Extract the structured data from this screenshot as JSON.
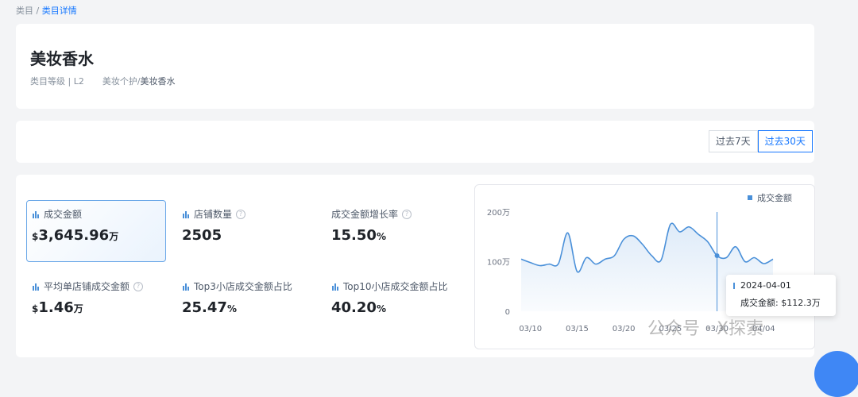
{
  "breadcrumb": {
    "root": "类目",
    "sep": "/",
    "current": "类目详情"
  },
  "category": {
    "title": "美妆香水",
    "level_label": "类目等级 | L2",
    "path_prefix": "美妆个护/",
    "path_current": "美妆香水"
  },
  "range": {
    "options": [
      "过去7天",
      "过去30天"
    ],
    "active": 1
  },
  "metrics": [
    {
      "label": "成交金额",
      "currency": "$",
      "value": "3,645.96",
      "unit": "万",
      "help": false,
      "icon": "bar-chart-icon",
      "selected": true
    },
    {
      "label": "店铺数量",
      "currency": "",
      "value": "2505",
      "unit": "",
      "help": true,
      "icon": "bar-chart-icon",
      "selected": false
    },
    {
      "label": "成交金额增长率",
      "currency": "",
      "value": "15.50",
      "unit": "%",
      "help": true,
      "icon": "",
      "selected": false
    },
    {
      "label": "平均单店铺成交金额",
      "currency": "$",
      "value": "1.46",
      "unit": "万",
      "help": true,
      "icon": "bar-chart-icon",
      "selected": false
    },
    {
      "label": "Top3小店成交金额占比",
      "currency": "",
      "value": "25.47",
      "unit": "%",
      "help": false,
      "icon": "bar-chart-icon",
      "selected": false
    },
    {
      "label": "Top10小店成交金额占比",
      "currency": "",
      "value": "40.20",
      "unit": "%",
      "help": false,
      "icon": "bar-chart-icon",
      "selected": false
    }
  ],
  "chart_data": {
    "type": "area",
    "series": [
      {
        "name": "成交金额",
        "color": "#4a90d9",
        "values": [
          105,
          98,
          92,
          95,
          96,
          158,
          80,
          108,
          95,
          105,
          112,
          145,
          152,
          135,
          112,
          103,
          175,
          160,
          170,
          155,
          140,
          112,
          108,
          130,
          100,
          108,
          96,
          105
        ]
      }
    ],
    "x": [
      "03/09",
      "03/10",
      "03/11",
      "03/12",
      "03/13",
      "03/14",
      "03/15",
      "03/16",
      "03/17",
      "03/18",
      "03/19",
      "03/20",
      "03/21",
      "03/22",
      "03/23",
      "03/24",
      "03/25",
      "03/26",
      "03/27",
      "03/28",
      "03/29",
      "03/30",
      "03/31",
      "04/01",
      "04/02",
      "04/03",
      "04/04",
      "04/05"
    ],
    "xticks": [
      "03/10",
      "03/15",
      "03/20",
      "03/25",
      "03/30",
      "04/04"
    ],
    "yticks": [
      "0",
      "100万",
      "200万"
    ],
    "ylim": [
      0,
      200
    ],
    "legend": "top-right",
    "grid": false,
    "highlight_index": 21,
    "tooltip": {
      "date": "2024-04-01",
      "label": "成交金额: $112.3万"
    }
  },
  "watermark": "公众号 · X探索"
}
